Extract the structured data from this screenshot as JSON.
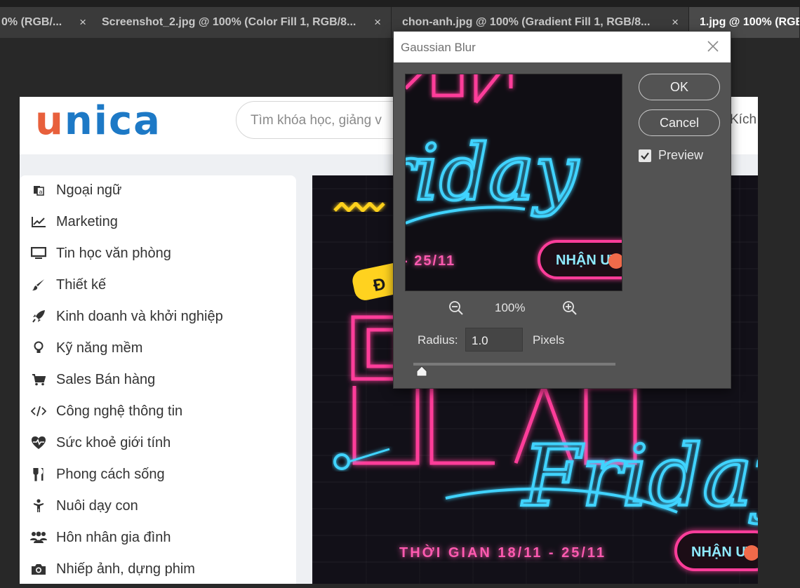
{
  "tabs": [
    {
      "label": "0% (RGB/...",
      "close": "×",
      "active": false
    },
    {
      "label": "Screenshot_2.jpg @ 100% (Color Fill 1, RGB/8...",
      "close": "×",
      "active": false
    },
    {
      "label": "chon-anh.jpg @ 100% (Gradient Fill 1, RGB/8...",
      "close": "×",
      "active": false
    },
    {
      "label": "1.jpg @ 100% (RGB",
      "close": "",
      "active": true
    }
  ],
  "document": {
    "logo_first": "u",
    "logo_rest": "nica",
    "search_placeholder": "Tìm khóa học, giảng v",
    "header_right_text": "Kích",
    "categories": [
      {
        "label": "Ngoại ngữ",
        "icon": "language-icon"
      },
      {
        "label": "Marketing",
        "icon": "chart-line-icon"
      },
      {
        "label": "Tin học văn phòng",
        "icon": "monitor-icon"
      },
      {
        "label": "Thiết kế",
        "icon": "brush-icon"
      },
      {
        "label": "Kinh doanh và khởi nghiệp",
        "icon": "rocket-icon"
      },
      {
        "label": "Kỹ năng mềm",
        "icon": "lightbulb-icon"
      },
      {
        "label": "Sales Bán hàng",
        "icon": "cart-icon"
      },
      {
        "label": "Công nghệ thông tin",
        "icon": "code-icon"
      },
      {
        "label": "Sức khoẻ giới tính",
        "icon": "heart-pulse-icon"
      },
      {
        "label": "Phong cách sống",
        "icon": "utensils-icon"
      },
      {
        "label": "Nuôi dạy con",
        "icon": "child-icon"
      },
      {
        "label": "Hôn nhân gia đình",
        "icon": "users-icon"
      },
      {
        "label": "Nhiếp ảnh, dựng phim",
        "icon": "camera-icon"
      }
    ],
    "banner": {
      "script_word": "Friday",
      "date_text": "THỜI GIAN 18/11 - 25/11",
      "cta": "NHẬN Ư",
      "badge": "Đ"
    }
  },
  "dialog": {
    "title": "Gaussian Blur",
    "ok_label": "OK",
    "cancel_label": "Cancel",
    "preview_label": "Preview",
    "preview_checked": true,
    "zoom": "100%",
    "radius_label": "Radius:",
    "radius_value": "1.0",
    "radius_unit": "Pixels",
    "preview_content": {
      "script_word": "riday",
      "date_text": "- 25/11",
      "cta": "NHẬN Ư"
    },
    "colors": {
      "neon_blue": "#3fd3ff",
      "neon_pink": "#ff3d9a",
      "neon_yellow": "#ffd21f"
    }
  }
}
